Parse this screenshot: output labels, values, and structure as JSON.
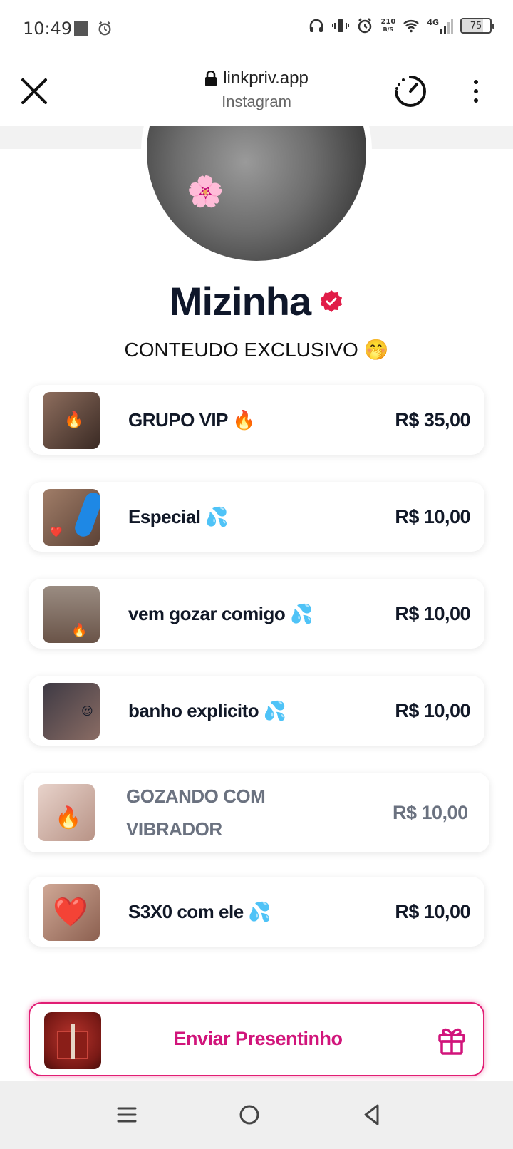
{
  "status_bar": {
    "time": "10:49",
    "net_speed_value": "210",
    "net_speed_unit": "B/S",
    "network_type": "4G",
    "battery_level": "75"
  },
  "browser": {
    "url": "linkpriv.app",
    "subtitle": "Instagram"
  },
  "profile": {
    "name": "Mizinha",
    "bio": "CONTEUDO EXCLUSIVO 🤭",
    "verified_color": "#e11d48"
  },
  "items": [
    {
      "title": "GRUPO VIP 🔥",
      "price": "R$ 35,00",
      "thumb_color": "#5a4338",
      "thumb_emoji": "🔥"
    },
    {
      "title": "Especial 💦",
      "price": "R$ 10,00",
      "thumb_color": "#8a6b5a",
      "thumb_emoji": "❤️"
    },
    {
      "title": "vem gozar comigo 💦",
      "price": "R$ 10,00",
      "thumb_color": "#6f6259",
      "thumb_emoji": "🔥"
    },
    {
      "title": "banho explicito 💦",
      "price": "R$ 10,00",
      "thumb_color": "#4e4a52",
      "thumb_emoji": "😍"
    },
    {
      "title": "GOZANDO COM VIBRADOR",
      "price": "R$ 10,00",
      "thumb_color": "#d9bfb4",
      "thumb_emoji": "🔥"
    },
    {
      "title": "S3X0 com ele 💦",
      "price": "R$ 10,00",
      "thumb_color": "#b98f7c",
      "thumb_emoji": "❤️"
    }
  ],
  "gift": {
    "label": "Enviar Presentinho",
    "accent_color": "#d1157b"
  },
  "icons": {
    "close": "close-icon",
    "lock": "lock-icon",
    "timer": "timer-icon",
    "menu": "kebab-menu-icon",
    "gift": "gift-icon"
  }
}
